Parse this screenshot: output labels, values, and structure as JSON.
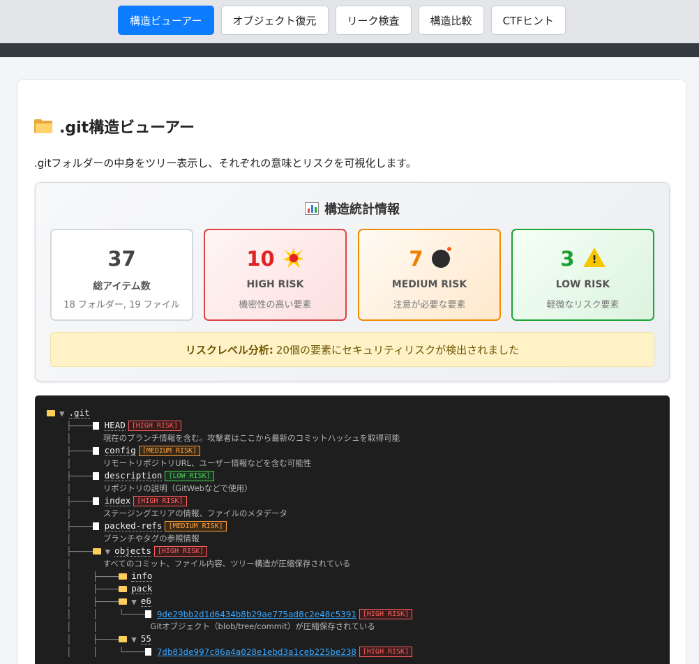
{
  "nav": {
    "tabs": [
      {
        "label": "構造ビューアー",
        "active": true
      },
      {
        "label": "オブジェクト復元",
        "active": false
      },
      {
        "label": "リーク検査",
        "active": false
      },
      {
        "label": "構造比較",
        "active": false
      },
      {
        "label": "CTFヒント",
        "active": false
      }
    ]
  },
  "main": {
    "title": ".git構造ビューアー",
    "description": ".gitフォルダーの中身をツリー表示し、それぞれの意味とリスクを可視化します。"
  },
  "stats": {
    "title": "構造統計情報",
    "total": {
      "num": "37",
      "label": "総アイテム数",
      "sub": "18 フォルダー, 19 ファイル"
    },
    "high": {
      "num": "10",
      "label": "HIGH RISK",
      "sub": "機密性の高い要素"
    },
    "medium": {
      "num": "7",
      "label": "MEDIUM RISK",
      "sub": "注意が必要な要素"
    },
    "low": {
      "num": "3",
      "label": "LOW RISK",
      "sub": "軽微なリスク要素"
    },
    "risk_label": "リスクレベル分析:",
    "risk_text": "20個の要素にセキュリティリスクが検出されました"
  },
  "tree": {
    "root": ".git",
    "badges": {
      "high": "[HIGH RISK]",
      "medium": "[MEDIUM RISK]",
      "low": "[LOW RISK]"
    },
    "items": [
      {
        "name": "HEAD",
        "risk": "high",
        "note": "現在のブランチ情報を含む。攻撃者はここから最新のコミットハッシュを取得可能"
      },
      {
        "name": "config",
        "risk": "medium",
        "note": "リモートリポジトリURL、ユーザー情報などを含む可能性"
      },
      {
        "name": "description",
        "risk": "low",
        "note": "リポジトリの説明（GitWebなどで使用）"
      },
      {
        "name": "index",
        "risk": "high",
        "note": "ステージングエリアの情報、ファイルのメタデータ"
      },
      {
        "name": "packed-refs",
        "risk": "medium",
        "note": "ブランチやタグの参照情報"
      },
      {
        "name": "objects",
        "risk": "high",
        "note": "すべてのコミット、ファイル内容、ツリー構造が圧縮保存されている"
      }
    ],
    "objects_children": {
      "info": "info",
      "pack": "pack",
      "e6": "e6",
      "e6_hash": "9de29bb2d1d6434b8b29ae775ad8c2e48c5391",
      "e6_note": "Gitオブジェクト（blob/tree/commit）が圧縮保存されている",
      "d55": "55",
      "d55_hash": "7db03de997c86a4a028e1ebd3a1ceb225be238"
    }
  }
}
